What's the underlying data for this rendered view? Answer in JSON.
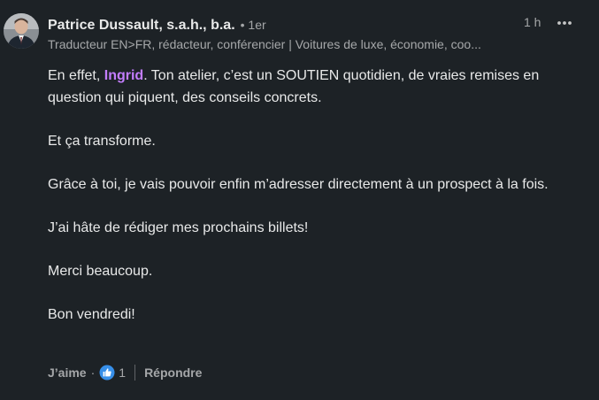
{
  "comment": {
    "author": {
      "name": "Patrice Dussault, s.a.h., b.a.",
      "degree": "• 1er",
      "headline": "Traducteur EN>FR, rédacteur, conférencier | Voitures de luxe, économie, coo..."
    },
    "timestamp": "1 h",
    "more_icon": "ellipsis-icon",
    "body": {
      "p1_before": "En effet, ",
      "p1_mention": "Ingrid",
      "p1_after": ". Ton atelier, c’est un SOUTIEN quotidien, de vraies remises en question qui piquent, des conseils concrets.",
      "p2": "Et ça transforme.",
      "p3": "Grâce à toi, je vais pouvoir enfin m’adresser directement à un prospect à la fois.",
      "p4": "J’ai hâte de rédiger mes prochains billets!",
      "p5": "Merci beaucoup.",
      "p6": "Bon vendredi!"
    },
    "actions": {
      "like_label": "J’aime",
      "separator": "·",
      "reaction_icon": "like-reaction-icon",
      "reaction_count": "1",
      "reply_label": "Répondre"
    },
    "colors": {
      "background": "#1d2226",
      "mention": "#c37dff",
      "like_blue": "#378fe9"
    }
  }
}
